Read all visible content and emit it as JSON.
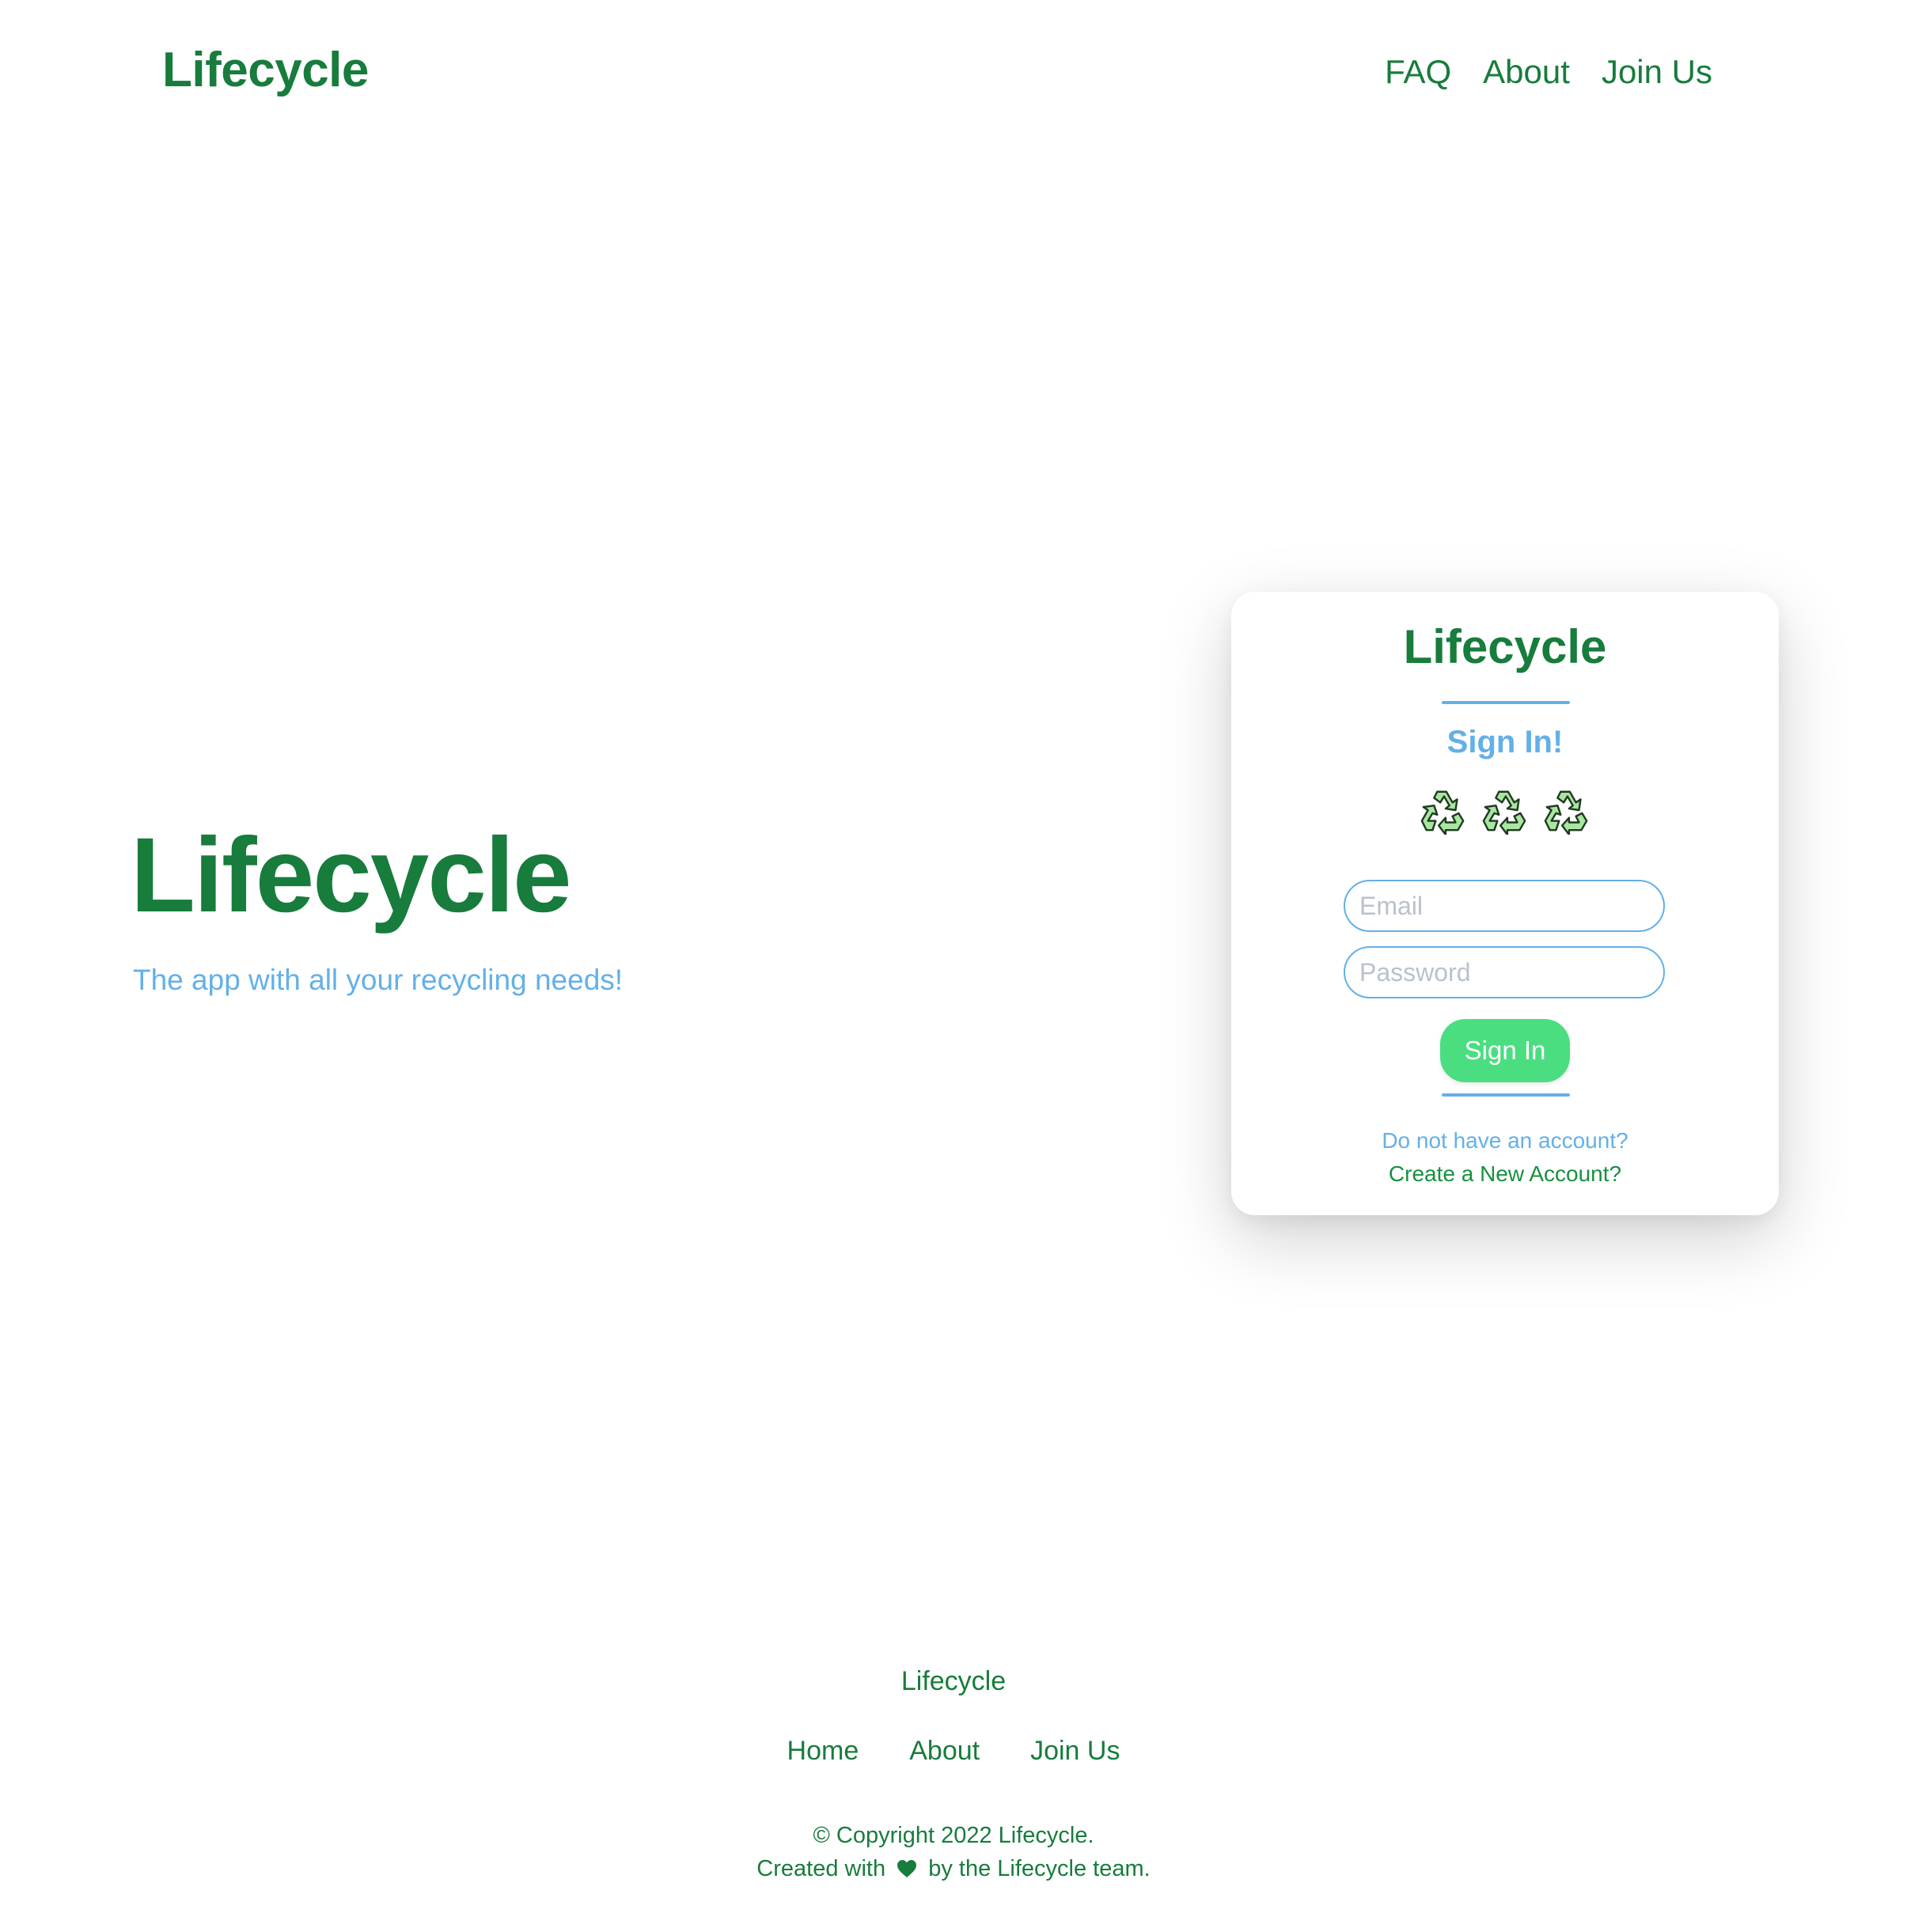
{
  "header": {
    "logo": "Lifecycle",
    "nav": [
      "FAQ",
      "About",
      "Join Us"
    ]
  },
  "hero": {
    "title": "Lifecycle",
    "subtitle": "The app with all your recycling needs!"
  },
  "signin_card": {
    "title": "Lifecycle",
    "subtitle": "Sign In!",
    "icons": [
      "recycle-icon",
      "recycle-icon",
      "recycle-icon"
    ],
    "email_placeholder": "Email",
    "password_placeholder": "Password",
    "submit_label": "Sign In",
    "no_account_text": "Do not have an account?",
    "create_account_link": "Create a New Account?"
  },
  "footer": {
    "brand": "Lifecycle",
    "nav": [
      "Home",
      "About",
      "Join Us"
    ],
    "copyright": "© Copyright 2022 Lifecycle.",
    "created_prefix": "Created with",
    "created_icon": "heart-icon",
    "created_suffix": "by the Lifecycle team."
  },
  "colors": {
    "brand_green": "#177c3c",
    "accent_blue": "#63b0e8",
    "button_green": "#4ade80"
  }
}
